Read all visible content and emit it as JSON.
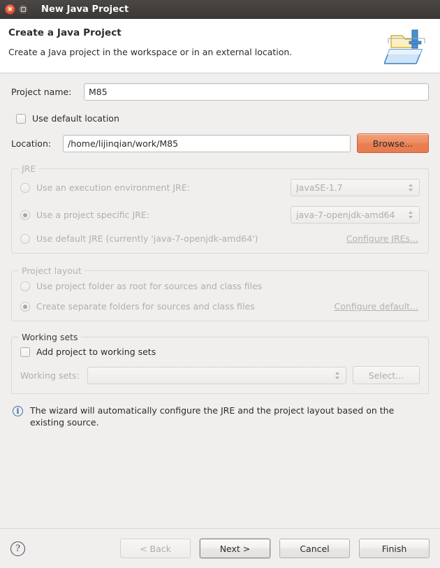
{
  "window": {
    "title": "New Java Project",
    "close_icon": "close-icon",
    "maximize_icon": "maximize-icon"
  },
  "header": {
    "title": "Create a Java Project",
    "description": "Create a Java project in the workspace or in an external location.",
    "icon": "new-java-project-wizard-icon"
  },
  "form": {
    "project_name_label": "Project name:",
    "project_name_value": "M85",
    "project_name_placeholder": "",
    "use_default_location_label": "Use default location",
    "use_default_location_checked": false,
    "location_label": "Location:",
    "location_value": "/home/lijinqian/work/M85",
    "location_placeholder": "",
    "browse_label": "Browse..."
  },
  "jre": {
    "group_title": "JRE",
    "disabled": true,
    "options": [
      {
        "label": "Use an execution environment JRE:",
        "selected": false,
        "combo_value": "JavaSE-1.7"
      },
      {
        "label": "Use a project specific JRE:",
        "selected": true,
        "combo_value": "java-7-openjdk-amd64"
      },
      {
        "label": "Use default JRE (currently 'java-7-openjdk-amd64')",
        "selected": false,
        "combo_value": null
      }
    ],
    "configure_link": "Configure JREs..."
  },
  "project_layout": {
    "group_title": "Project layout",
    "disabled": true,
    "options": [
      {
        "label": "Use project folder as root for sources and class files",
        "selected": false
      },
      {
        "label": "Create separate folders for sources and class files",
        "selected": true
      }
    ],
    "configure_link": "Configure default..."
  },
  "working_sets": {
    "group_title": "Working sets",
    "add_checkbox_label": "Add project to working sets",
    "add_checkbox_checked": false,
    "working_sets_label": "Working sets:",
    "working_sets_value": "",
    "select_label": "Select..."
  },
  "info": {
    "icon": "info-icon",
    "message": "The wizard will automatically configure the JRE and the project layout based on the existing source."
  },
  "footer": {
    "help_icon": "help-icon",
    "back_label": "< Back",
    "back_disabled": true,
    "next_label": "Next >",
    "next_default": true,
    "cancel_label": "Cancel",
    "finish_label": "Finish"
  },
  "colors": {
    "titlebar_bg": "#3c3836",
    "close_red": "#e2553a",
    "browse_orange": "#ee8a5f",
    "body_bg": "#f0efee",
    "info_blue": "#3a6ea5",
    "link_disabled": "#b5b1ad"
  }
}
